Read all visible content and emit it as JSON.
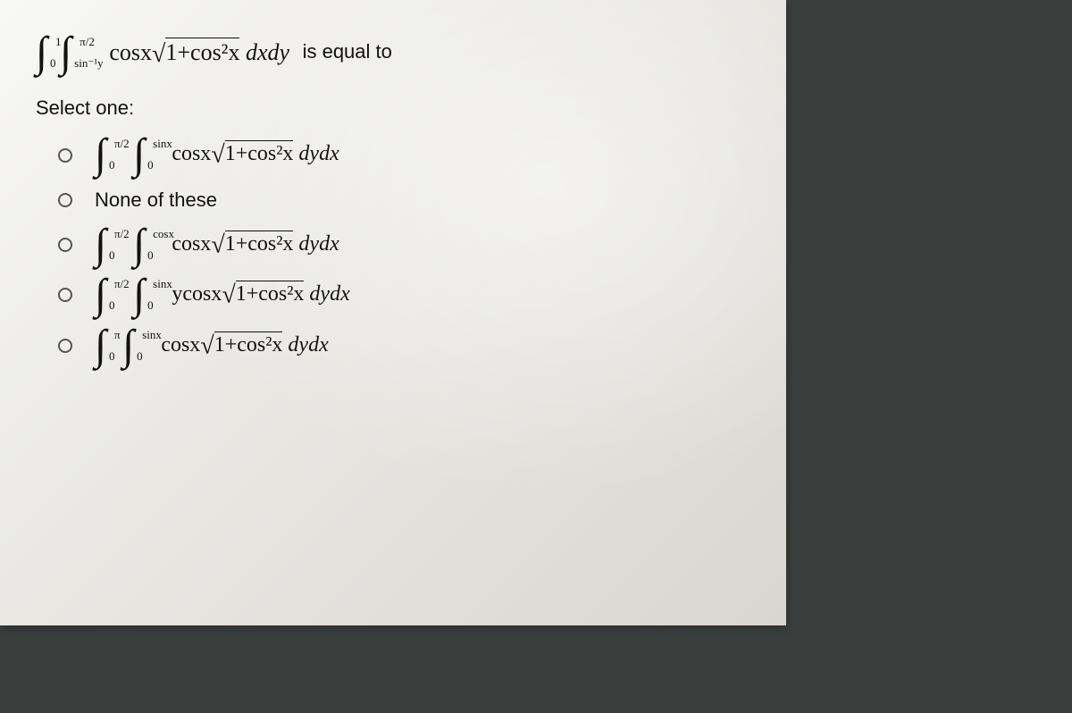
{
  "question": {
    "int_outer_upper": "1",
    "int_outer_lower": "0",
    "int_inner_upper": "π/2",
    "int_inner_lower": "sin⁻¹y",
    "integrand_prefix": "cosx",
    "sqrt_content": "1+cos²x",
    "diff": "dxdy",
    "tail": "is equal to"
  },
  "prompt": "Select one:",
  "options": {
    "a": {
      "int_outer_upper": "π/2",
      "int_outer_lower": "0",
      "int_inner_upper": "sinx",
      "int_inner_lower": "0",
      "integrand_prefix": "cosx",
      "sqrt_content": "1+cos²x",
      "diff": "dydx"
    },
    "b": {
      "text": "None of these"
    },
    "c": {
      "int_outer_upper": "π/2",
      "int_outer_lower": "0",
      "int_inner_upper": "cosx",
      "int_inner_lower": "0",
      "integrand_prefix": "cosx",
      "sqrt_content": "1+cos²x",
      "diff": "dydx"
    },
    "d": {
      "int_outer_upper": "π/2",
      "int_outer_lower": "0",
      "int_inner_upper": "sinx",
      "int_inner_lower": "0",
      "integrand_prefix": "ycosx",
      "sqrt_content": "1+cos²x",
      "diff": "dydx"
    },
    "e": {
      "int_outer_upper": "π",
      "int_outer_lower": "0",
      "int_inner_upper": "sinx",
      "int_inner_lower": "0",
      "integrand_prefix": "cosx",
      "sqrt_content": "1+cos²x",
      "diff": "dydx"
    }
  }
}
